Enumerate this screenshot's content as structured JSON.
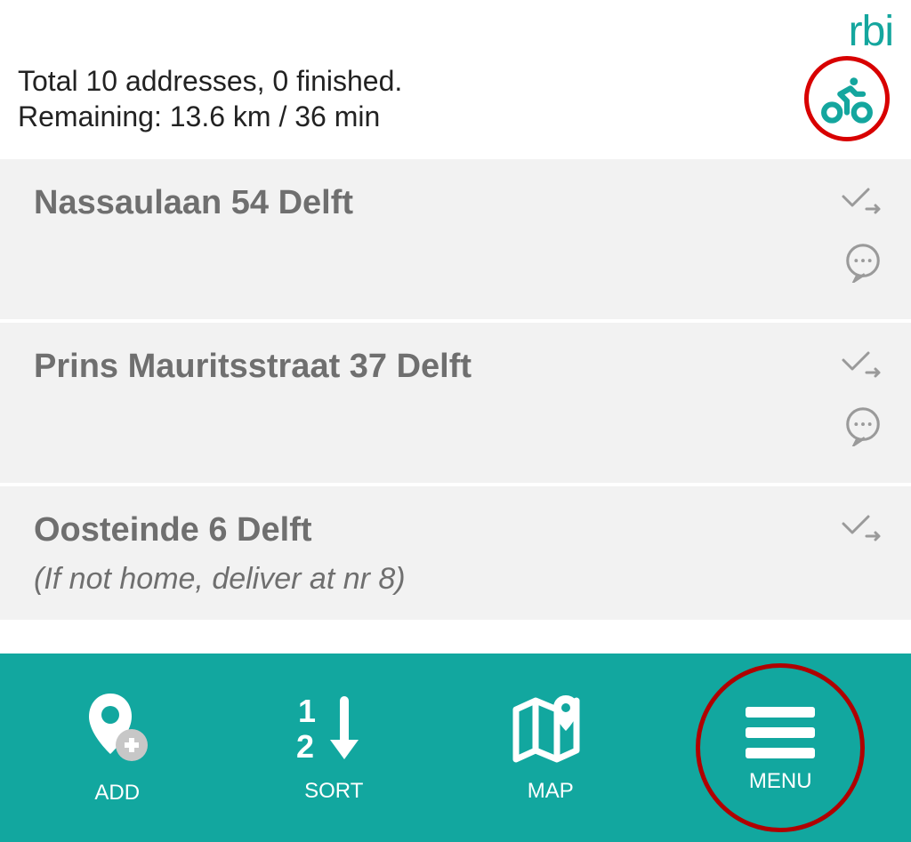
{
  "brand": {
    "logo_text": "rbi"
  },
  "status": {
    "line1": "Total 10 addresses, 0 finished.",
    "line2": "Remaining: 13.6 km / 36 min"
  },
  "colors": {
    "accent": "#14a69e",
    "highlight_ring": "#d80000"
  },
  "vehicle": {
    "mode_icon": "cyclist-icon"
  },
  "addresses": [
    {
      "address": "Nassaulaan 54 Delft",
      "note": "",
      "has_comment_icon": true
    },
    {
      "address": "Prins Mauritsstraat 37 Delft",
      "note": "",
      "has_comment_icon": true
    },
    {
      "address": "Oosteinde 6 Delft",
      "note": "(If not home, deliver at nr 8)",
      "has_comment_icon": false
    }
  ],
  "nav": {
    "add": {
      "label": "ADD",
      "icon": "add-pin-icon"
    },
    "sort": {
      "label": "SORT",
      "icon": "sort-12-icon"
    },
    "map": {
      "label": "MAP",
      "icon": "map-pin-icon"
    },
    "menu": {
      "label": "MENU",
      "icon": "hamburger-icon"
    }
  }
}
